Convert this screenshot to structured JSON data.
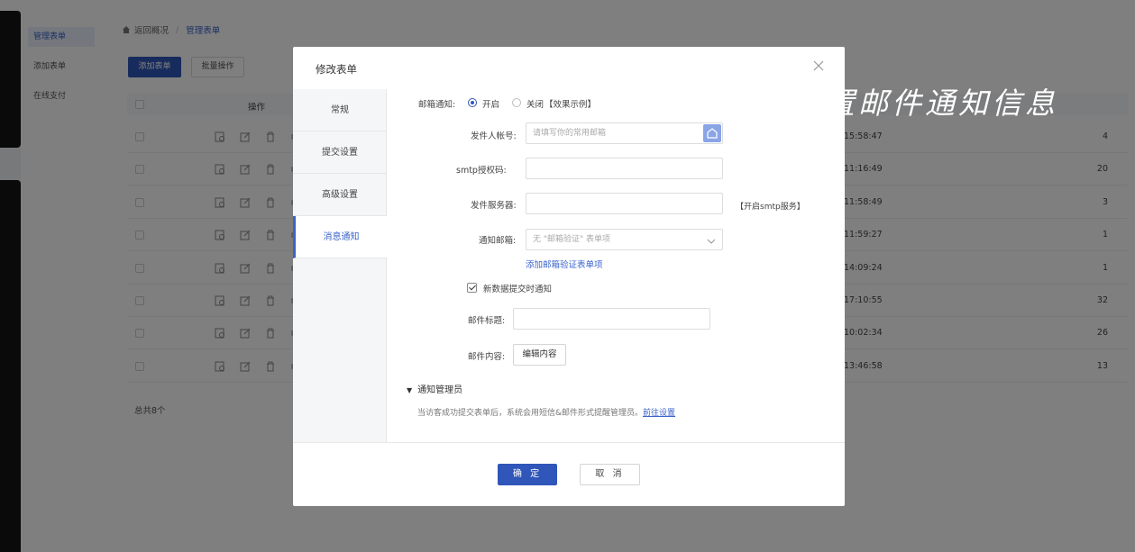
{
  "sidebar": {
    "items": [
      {
        "label": "管理表单"
      },
      {
        "label": "添加表单"
      },
      {
        "label": "在线支付"
      }
    ]
  },
  "breadcrumb": {
    "home": "返回概况",
    "current": "管理表单"
  },
  "toolbar": {
    "add_label": "添加表单",
    "batch_label": "批量操作"
  },
  "table": {
    "op_header": "操作",
    "rows": [
      {
        "time": "15:58:47",
        "count": "4"
      },
      {
        "time": "11:16:49",
        "count": "20"
      },
      {
        "time": "11:58:49",
        "count": "3"
      },
      {
        "time": "11:59:27",
        "count": "1"
      },
      {
        "time": "14:09:24",
        "count": "1"
      },
      {
        "time": "17:10:55",
        "count": "32"
      },
      {
        "time": "10:02:34",
        "count": "26"
      },
      {
        "time": "13:46:58",
        "count": "13"
      }
    ],
    "total": "总共8个"
  },
  "dialog": {
    "title": "修改表单",
    "nav": [
      {
        "label": "常规"
      },
      {
        "label": "提交设置"
      },
      {
        "label": "高级设置"
      },
      {
        "label": "消息通知"
      }
    ],
    "ok": "确 定",
    "cancel": "取 消",
    "admin_section": "通知管理员",
    "admin_desc": "当访客成功提交表单后，系统会用短信&邮件形式提醒管理员。",
    "admin_link": "前往设置",
    "smtp_hint": "【开启smtp服务】"
  },
  "email": {
    "notify_label": "邮箱通知:",
    "on_label": "开启",
    "off_label": "关闭",
    "example": "【效果示例】",
    "sender_label": "发件人帐号:",
    "sender_placeholder": "请填写你的常用邮箱",
    "smtp_label": "smtp授权码:",
    "server_label": "发件服务器:",
    "notify_mail_label": "通知邮箱:",
    "notify_mail_value": "无 \"邮箱验证\" 表单项",
    "add_link": "添加邮箱验证表单项",
    "new_data_label": "新数据提交时通知",
    "subject_label": "邮件标题:",
    "content_label": "邮件内容:",
    "edit_btn": "编辑内容"
  },
  "annotation": "设置邮件通知信息",
  "colors": {
    "accent": "#2f56b8",
    "link": "#3b63c9"
  }
}
